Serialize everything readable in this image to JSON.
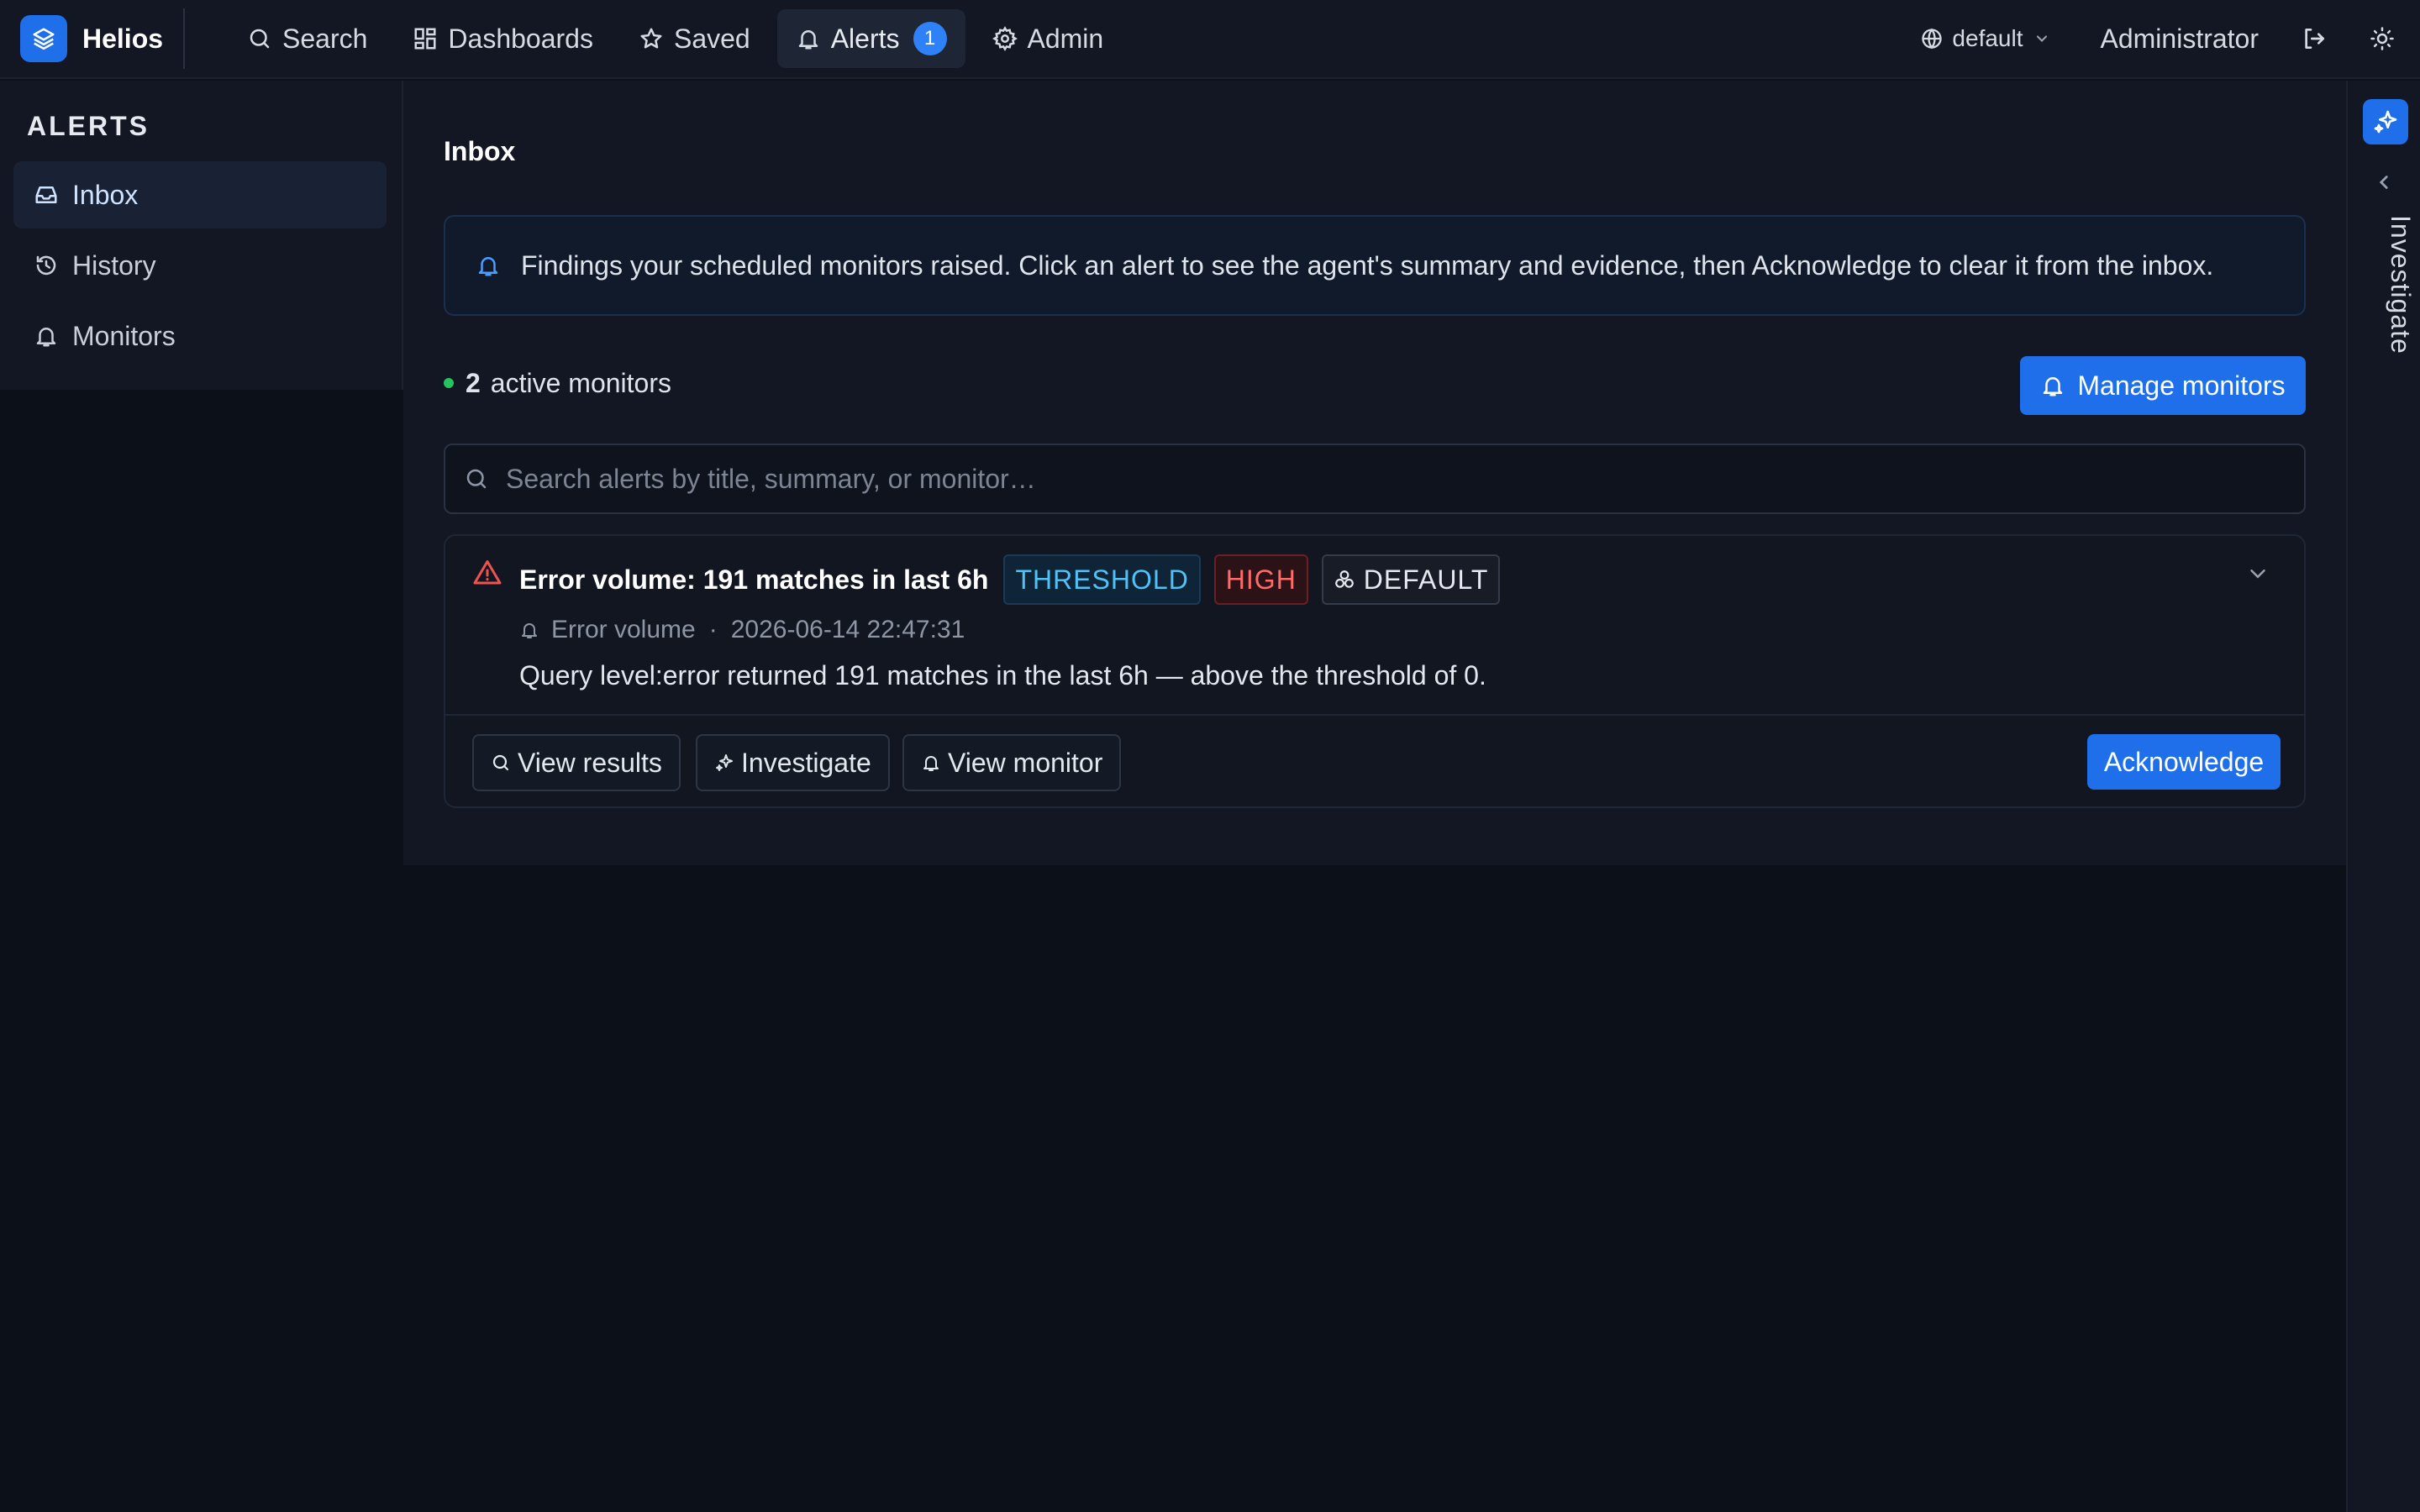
{
  "app": {
    "name": "Helios",
    "brand_color": "#1f6feb"
  },
  "nav": {
    "items": [
      {
        "label": "Search",
        "icon": "search-icon"
      },
      {
        "label": "Dashboards",
        "icon": "dashboard-icon"
      },
      {
        "label": "Saved",
        "icon": "star-icon"
      },
      {
        "label": "Alerts",
        "icon": "bell-icon",
        "badge": "1",
        "active": true
      },
      {
        "label": "Admin",
        "icon": "gear-icon"
      }
    ]
  },
  "header": {
    "workspace": "default",
    "user": "Administrator",
    "icons": [
      "globe-icon",
      "chevron-down-icon",
      "logout-icon",
      "sun-icon"
    ]
  },
  "sidebar": {
    "title": "ALERTS",
    "items": [
      {
        "label": "Inbox",
        "icon": "inbox-icon",
        "active": true
      },
      {
        "label": "History",
        "icon": "history-icon"
      },
      {
        "label": "Monitors",
        "icon": "bell-icon"
      }
    ]
  },
  "main": {
    "title": "Inbox",
    "banner": "Findings your scheduled monitors raised. Click an alert to see the agent's summary and evidence, then Acknowledge to clear it from the inbox.",
    "active_monitors_count": "2",
    "active_monitors_label": "active monitors",
    "manage_button": "Manage monitors",
    "search_placeholder": "Search alerts by title, summary, or monitor…",
    "alerts": [
      {
        "title": "Error volume: 191 matches in last 6h",
        "tags": {
          "type": "THRESHOLD",
          "severity": "HIGH",
          "workspace": "DEFAULT"
        },
        "monitor": "Error volume",
        "separator": "·",
        "timestamp": "2026-06-14 22:47:31",
        "summary": "Query level:error returned 191 matches in the last 6h — above the threshold of 0.",
        "actions": {
          "view_results": "View results",
          "investigate": "Investigate",
          "view_monitor": "View monitor"
        },
        "acknowledge": "Acknowledge"
      }
    ]
  },
  "right_rail": {
    "label": "Investigate"
  },
  "colors": {
    "background": "#0c1018",
    "panel": "#121723",
    "accent": "#1f6feb",
    "threshold": "#4fc3f7",
    "high": "#ff6b6b",
    "status_active": "#22c55e"
  }
}
